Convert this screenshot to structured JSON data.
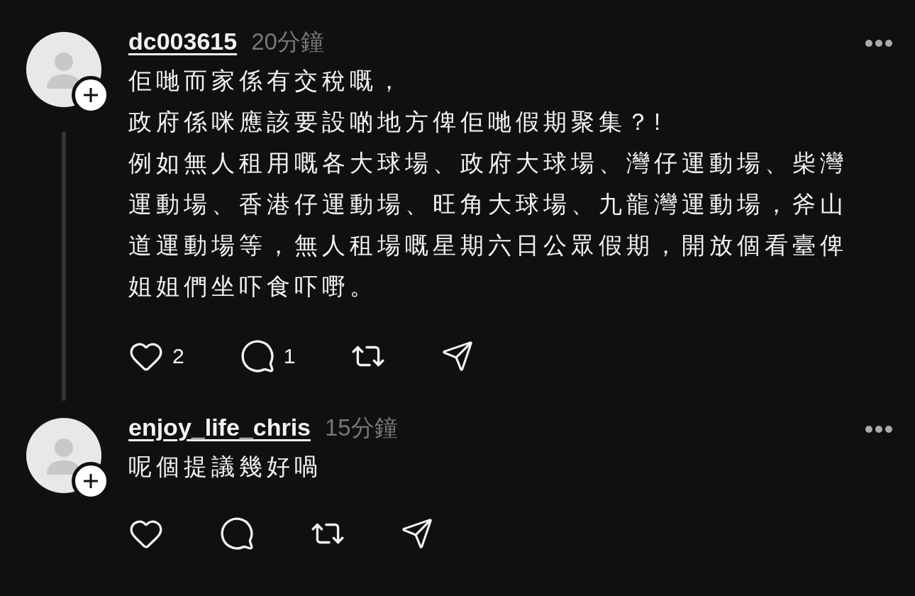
{
  "posts": [
    {
      "username": "dc003615",
      "time": "20分鐘",
      "paragraphs": [
        "佢哋而家係有交稅嘅，",
        "政府係咪應該要設啲地方俾佢哋假期聚集？!",
        "例如無人租用嘅各大球場、政府大球場、灣仔運動場、柴灣運動場、香港仔運動場、旺角大球場、九龍灣運動場，斧山道運動場等，無人租場嘅星期六日公眾假期，開放個看臺俾姐姐們坐吓食吓嘢。"
      ],
      "likes": "2",
      "replies": "1",
      "thread_line": true
    },
    {
      "username": "enjoy_life_chris",
      "time": "15分鐘",
      "paragraphs": [
        "呢個提議幾好喎"
      ]
    }
  ]
}
